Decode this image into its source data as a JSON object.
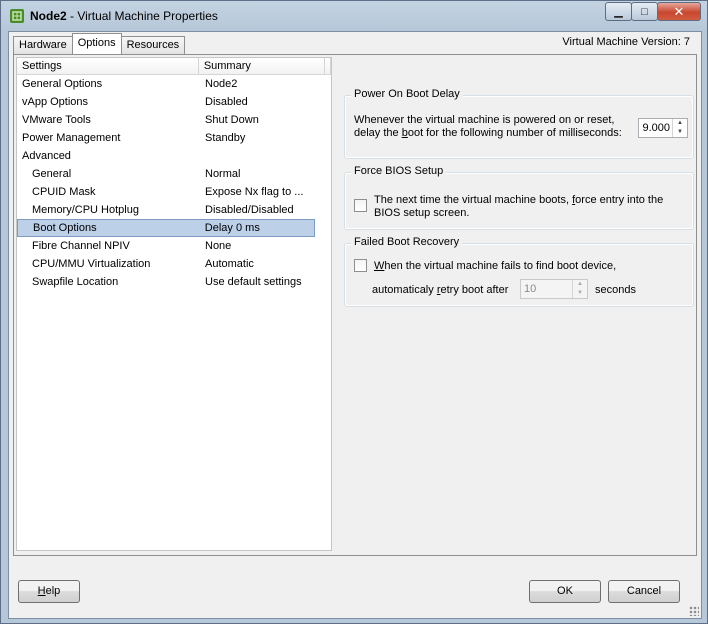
{
  "window": {
    "title_bold": "Node2",
    "title_rest": " - Virtual Machine Properties",
    "min_glyph": "▁",
    "max_glyph": "□",
    "close_glyph": "✕"
  },
  "tabs": [
    "Hardware",
    "Options",
    "Resources"
  ],
  "version_label": "Virtual Machine Version: 7",
  "settings_list": {
    "headers": {
      "settings": "Settings",
      "summary": "Summary"
    },
    "rows": [
      {
        "name": "General Options",
        "summary": "Node2"
      },
      {
        "name": "vApp Options",
        "summary": "Disabled"
      },
      {
        "name": "VMware Tools",
        "summary": "Shut Down"
      },
      {
        "name": "Power Management",
        "summary": "Standby"
      },
      {
        "name": "Advanced",
        "summary": ""
      },
      {
        "name": "General",
        "summary": "Normal"
      },
      {
        "name": "CPUID Mask",
        "summary": "Expose Nx flag to ..."
      },
      {
        "name": "Memory/CPU Hotplug",
        "summary": "Disabled/Disabled"
      },
      {
        "name": "Boot Options",
        "summary": "Delay 0 ms"
      },
      {
        "name": "Fibre Channel NPIV",
        "summary": "None"
      },
      {
        "name": "CPU/MMU Virtualization",
        "summary": "Automatic"
      },
      {
        "name": "Swapfile Location",
        "summary": "Use default settings"
      }
    ]
  },
  "power_on_boot_delay": {
    "title": "Power On Boot Delay",
    "line1": "Whenever the virtual machine is powered on or reset,",
    "line2_pre": "delay the ",
    "line2_u": "b",
    "line2_post": "oot for the following number of milliseconds:",
    "value": "9.000"
  },
  "force_bios": {
    "title": "Force BIOS Setup",
    "line1_pre": "The next time the virtual machine boots, ",
    "line1_u": "f",
    "line1_post": "orce entry into the",
    "line2": "BIOS setup screen.",
    "checked": false
  },
  "failed_boot": {
    "title": "Failed Boot Recovery",
    "line1_u": "W",
    "line1_post": "hen the virtual machine fails to find boot device,",
    "line2_pre": "automaticaly ",
    "line2_u": "r",
    "line2_post": "etry boot after",
    "value": "10",
    "unit": "seconds",
    "checked": false
  },
  "buttons": {
    "help_u": "H",
    "help_rest": "elp",
    "ok": "OK",
    "cancel": "Cancel"
  }
}
